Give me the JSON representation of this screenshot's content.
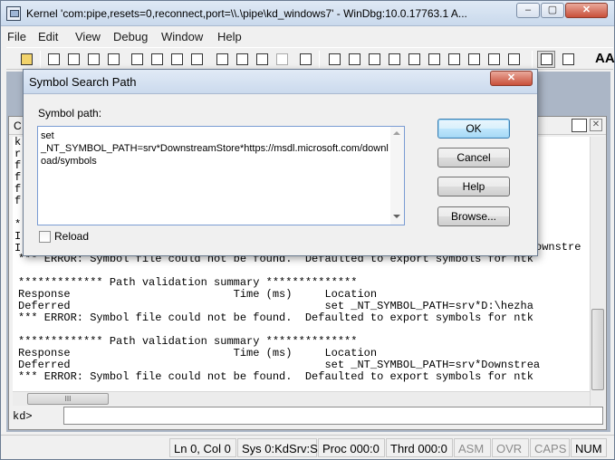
{
  "window": {
    "title": "Kernel 'com:pipe,resets=0,reconnect,port=\\\\.\\pipe\\kd_windows7' - WinDbg:10.0.17763.1 A...",
    "min_glyph": "‒",
    "max_glyph": "▢",
    "close_glyph": "✕"
  },
  "menu": [
    "File",
    "Edit",
    "View",
    "Debug",
    "Window",
    "Help"
  ],
  "command_window": {
    "caption_letter": "C",
    "left_fragments": [
      "k",
      "r",
      "f",
      "f",
      "f",
      "f",
      "*",
      "I",
      "I"
    ],
    "output_lines": [
      "*** ERROR: Symbol file could not be found.  Defaulted to export symbols for ntk",
      "",
      "************* Path validation summary **************",
      "Response                         Time (ms)     Location",
      "Deferred                                       set _NT_SYMBOL_PATH=srv*D:\\hezha",
      "*** ERROR: Symbol file could not be found.  Defaulted to export symbols for ntk",
      "",
      "************* Path validation summary **************",
      "Response                         Time (ms)     Location",
      "Deferred                                       set _NT_SYMBOL_PATH=srv*Downstrea",
      "*** ERROR: Symbol file could not be found.  Defaulted to export symbols for ntk"
    ],
    "right_fragment": "ownstre",
    "prompt": "kd>",
    "input_value": "",
    "hscroll_grip": "III"
  },
  "status_bar": {
    "position": "Ln 0, Col 0",
    "system": "Sys 0:KdSrv:S",
    "process": "Proc 000:0",
    "thread": "Thrd 000:0",
    "asm": "ASM",
    "ovr": "OVR",
    "caps": "CAPS",
    "num": "NUM"
  },
  "dialog": {
    "title": "Symbol Search Path",
    "close_glyph": "✕",
    "label": "Symbol path:",
    "path_value": "set\n_NT_SYMBOL_PATH=srv*DownstreamStore*https://msdl.microsoft.com/download/symbols",
    "reload_label": "Reload",
    "reload_checked": false,
    "ok_label": "OK",
    "cancel_label": "Cancel",
    "help_label": "Help",
    "browse_label": "Browse..."
  },
  "toolbar": {
    "font_glyph": "AA"
  }
}
